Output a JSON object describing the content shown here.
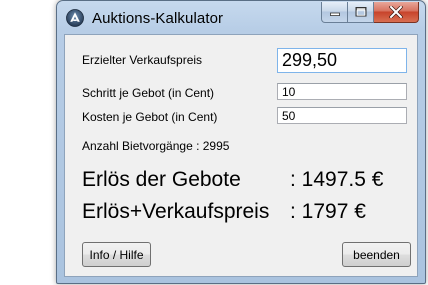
{
  "window": {
    "title": "Auktions-Kalkulator"
  },
  "form": {
    "sale_price_label": "Erzielter Verkaufspreis",
    "sale_price_value": "299,50",
    "step_label": "Schritt je Gebot (in Cent)",
    "step_value": "10",
    "cost_label": "Kosten je Gebot (in Cent)",
    "cost_value": "50",
    "bid_count_text": "Anzahl Bietvorgänge : 2995"
  },
  "results": {
    "bids_revenue_label": "Erlös der Gebote",
    "bids_revenue_value": ": 1497.5 €",
    "total_revenue_label": "Erlös+Verkaufspreis",
    "total_revenue_value": ": 1797 €"
  },
  "buttons": {
    "help_label": "Info / Hilfe",
    "quit_label": "beenden"
  },
  "icons": {
    "app": "auction-app-icon",
    "minimize": "minimize-icon",
    "maximize": "maximize-icon",
    "close": "close-icon"
  }
}
